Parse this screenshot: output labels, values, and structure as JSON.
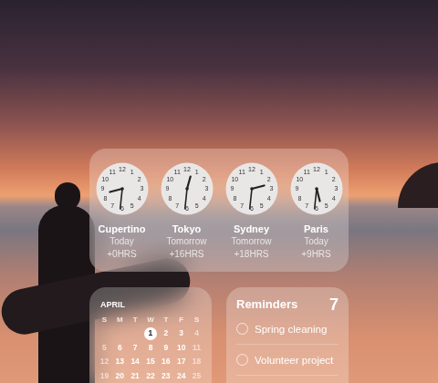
{
  "world_clock": {
    "dial": [
      "12",
      "1",
      "2",
      "3",
      "4",
      "5",
      "6",
      "7",
      "8",
      "9",
      "10",
      "11"
    ],
    "clocks": [
      {
        "city": "Cupertino",
        "day": "Today",
        "offset": "+0HRS",
        "hours": 8,
        "minutes": 31
      },
      {
        "city": "Tokyo",
        "day": "Tomorrow",
        "offset": "+16HRS",
        "hours": 0,
        "minutes": 31
      },
      {
        "city": "Sydney",
        "day": "Tomorrow",
        "offset": "+18HRS",
        "hours": 2,
        "minutes": 31
      },
      {
        "city": "Paris",
        "day": "Today",
        "offset": "+9HRS",
        "hours": 5,
        "minutes": 31
      }
    ]
  },
  "calendar": {
    "month": "APRIL",
    "weekdays": [
      "S",
      "M",
      "T",
      "W",
      "T",
      "F",
      "S"
    ],
    "weeks": [
      [
        {
          "day": "",
          "selected": false,
          "dim": true
        },
        {
          "day": "",
          "selected": false,
          "dim": false
        },
        {
          "day": "",
          "selected": false,
          "dim": false
        },
        {
          "day": "1",
          "selected": true,
          "dim": false
        },
        {
          "day": "2",
          "selected": false,
          "dim": false
        },
        {
          "day": "3",
          "selected": false,
          "dim": false
        },
        {
          "day": "4",
          "selected": false,
          "dim": true
        }
      ],
      [
        {
          "day": "5",
          "selected": false,
          "dim": true
        },
        {
          "day": "6",
          "selected": false,
          "dim": false
        },
        {
          "day": "7",
          "selected": false,
          "dim": false
        },
        {
          "day": "8",
          "selected": false,
          "dim": false
        },
        {
          "day": "9",
          "selected": false,
          "dim": false
        },
        {
          "day": "10",
          "selected": false,
          "dim": false
        },
        {
          "day": "11",
          "selected": false,
          "dim": true
        }
      ],
      [
        {
          "day": "12",
          "selected": false,
          "dim": true
        },
        {
          "day": "13",
          "selected": false,
          "dim": false
        },
        {
          "day": "14",
          "selected": false,
          "dim": false
        },
        {
          "day": "15",
          "selected": false,
          "dim": false
        },
        {
          "day": "16",
          "selected": false,
          "dim": false
        },
        {
          "day": "17",
          "selected": false,
          "dim": false
        },
        {
          "day": "18",
          "selected": false,
          "dim": true
        }
      ],
      [
        {
          "day": "19",
          "selected": false,
          "dim": true
        },
        {
          "day": "20",
          "selected": false,
          "dim": false
        },
        {
          "day": "21",
          "selected": false,
          "dim": false
        },
        {
          "day": "22",
          "selected": false,
          "dim": false
        },
        {
          "day": "23",
          "selected": false,
          "dim": false
        },
        {
          "day": "24",
          "selected": false,
          "dim": false
        },
        {
          "day": "25",
          "selected": false,
          "dim": true
        }
      ]
    ]
  },
  "reminders": {
    "title": "Reminders",
    "count": "7",
    "items": [
      {
        "text": "Spring cleaning",
        "done": false
      },
      {
        "text": "Volunteer project",
        "done": false
      }
    ]
  }
}
